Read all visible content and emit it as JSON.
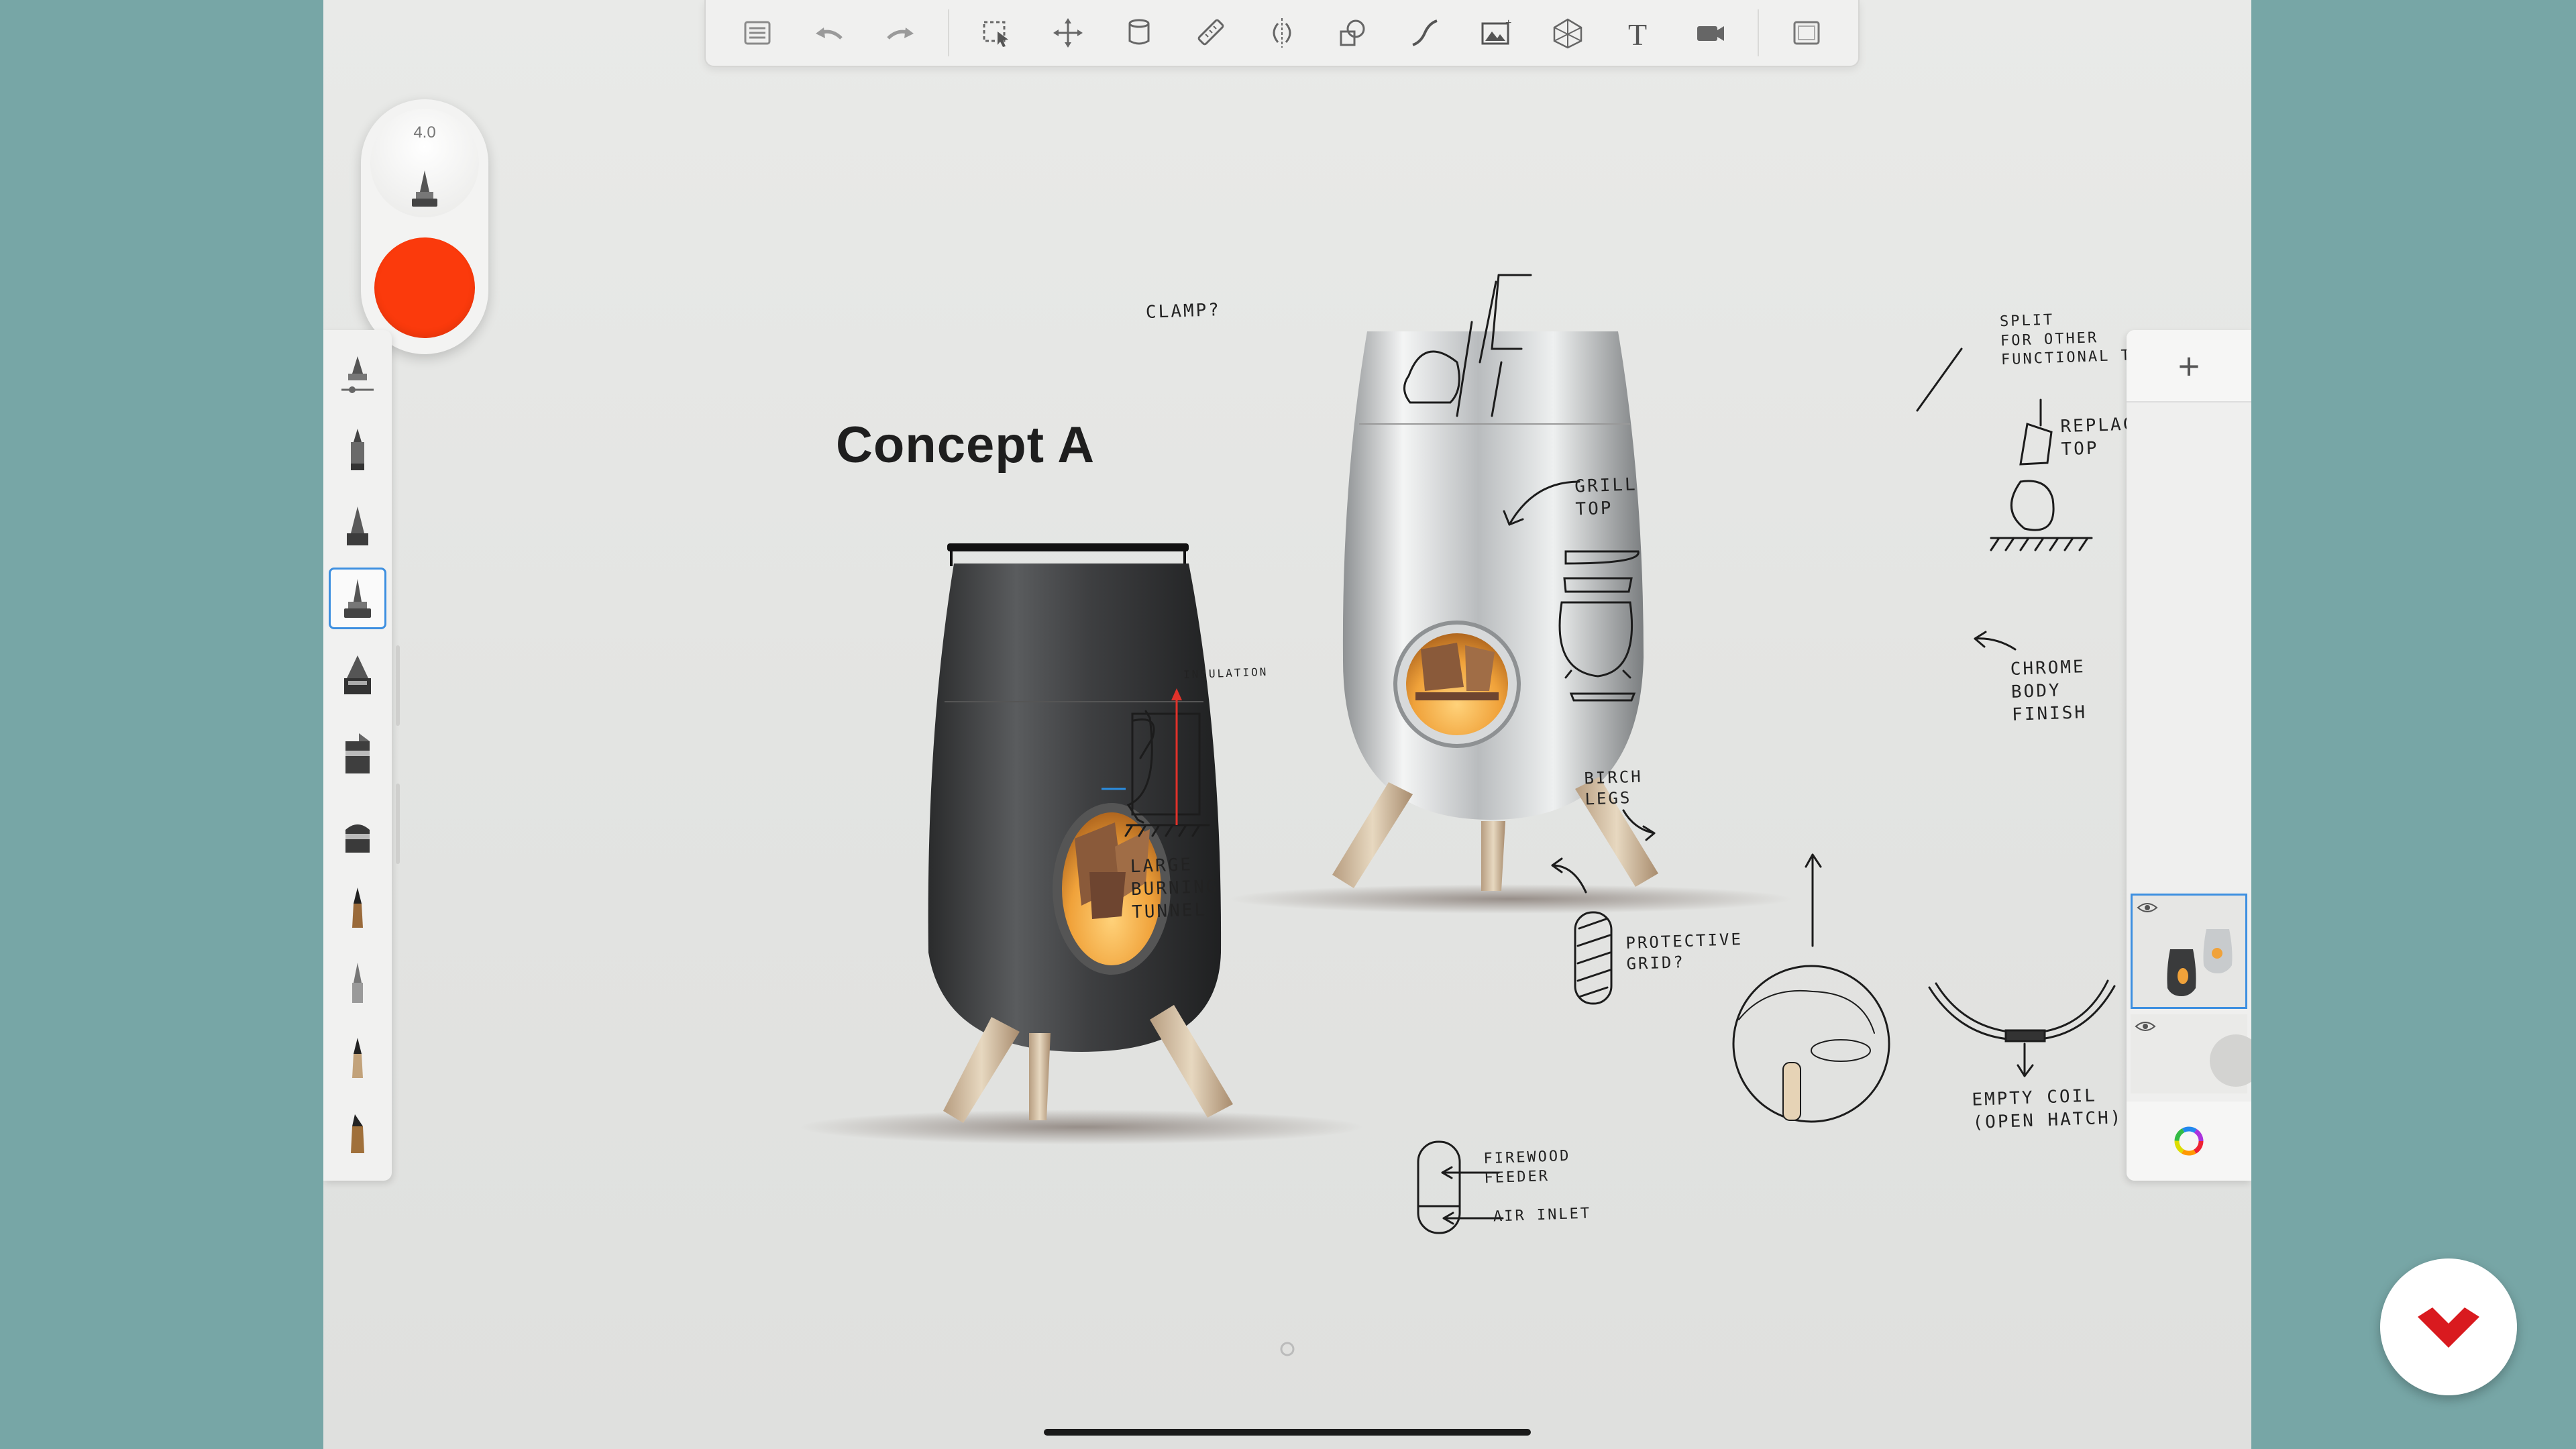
{
  "toolbar": {
    "items": [
      "menu",
      "undo",
      "redo",
      "selection",
      "transform",
      "canvas",
      "ruler",
      "symmetry",
      "shapes",
      "curve",
      "import-image",
      "perspective-grid",
      "text",
      "record",
      "fullscreen"
    ]
  },
  "brush_puck": {
    "size_label": "4.0",
    "color": "#fb3a0c"
  },
  "brush_palette": {
    "selected_index": 3,
    "brushes": [
      "brush-settings",
      "marker",
      "pen",
      "ballpoint",
      "airbrush",
      "paintbrush",
      "flat-brush",
      "pencil",
      "fineliner",
      "ink-pen",
      "chisel-marker"
    ]
  },
  "layers": {
    "add_label": "+",
    "layer_count": 2
  },
  "canvas": {
    "title": "Concept A",
    "notes": {
      "clamp": "CLAMP?",
      "split": "SPLIT\nFOR OTHER\nFUNCTIONAL TOPS",
      "replace_top": "REPLACE\nTOP",
      "grill_top": "GRILL\nTOP",
      "insulation": "INSULATION",
      "chrome": "CHROME\nBODY\nFINISH",
      "birch": "BIRCH\nLEGS",
      "burning": "LARGE\nBURNING\nTUNNEL",
      "protective": "PROTECTIVE\nGRID?",
      "ashtray": "EMPTY COIL\n(OPEN HATCH)",
      "firewood": "FIREWOOD\nFEEDER",
      "air_inlet": "AIR INLET"
    }
  },
  "colors": {
    "accent": "#3d8fe0",
    "brush_color": "#fb3a0c",
    "brand": "#d91a1f"
  }
}
